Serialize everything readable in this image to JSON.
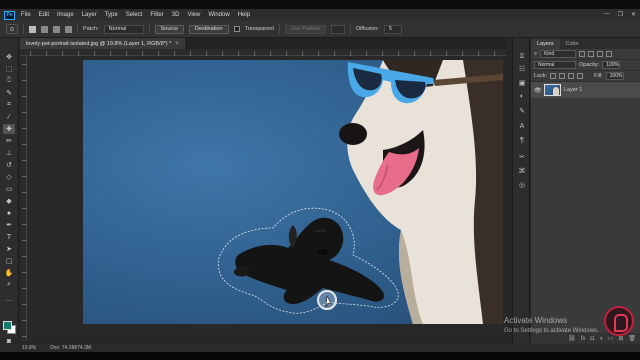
{
  "app": {
    "logo": "Ps",
    "menu": [
      "File",
      "Edit",
      "Image",
      "Layer",
      "Type",
      "Select",
      "Filter",
      "3D",
      "View",
      "Window",
      "Help"
    ],
    "window_controls": [
      "—",
      "❐",
      "✕"
    ]
  },
  "options_bar": {
    "patch_label": "Patch:",
    "patch_value": "Normal",
    "source_label": "Source",
    "destination_label": "Destination",
    "transparent_label": "Transparent",
    "use_pattern_label": "Use Pattern",
    "diffusion_label": "Diffusion:",
    "diffusion_value": "5"
  },
  "document": {
    "tab_title": "lovely-pet-portrait-isolated.jpg @ 19.8% (Layer 1, RGB/8*) *",
    "close": "×"
  },
  "status_bar": {
    "zoom": "19.8%",
    "doc": "Doc: 74.3M/74.3M"
  },
  "layers_panel": {
    "tabs": [
      "Layers",
      "Color"
    ],
    "filter_value": "Kind",
    "blend_mode": "Normal",
    "opacity_label": "Opacity:",
    "opacity_value": "100%",
    "lock_label": "Lock:",
    "fill_label": "Fill:",
    "fill_value": "100%",
    "layers": [
      {
        "name": "Layer 1",
        "visible": true,
        "selected": true
      }
    ]
  },
  "watermark": {
    "line1": "Activate Windows",
    "line2": "Go to Settings to activate Windows."
  },
  "colors": {
    "foreground": "#137b6f",
    "background": "#ffffff",
    "canvas_bg": "#2f5f8d",
    "accent": "#31a8ff"
  }
}
